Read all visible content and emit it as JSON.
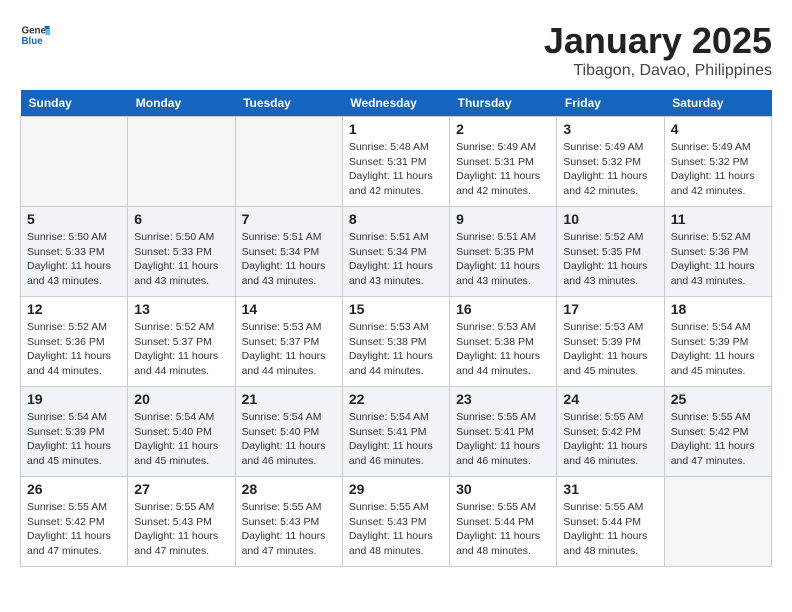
{
  "logo": {
    "text_general": "General",
    "text_blue": "Blue"
  },
  "title": "January 2025",
  "location": "Tibagon, Davao, Philippines",
  "days_of_week": [
    "Sunday",
    "Monday",
    "Tuesday",
    "Wednesday",
    "Thursday",
    "Friday",
    "Saturday"
  ],
  "weeks": [
    [
      {
        "day": "",
        "sunrise": "",
        "sunset": "",
        "daylight": "",
        "empty": true
      },
      {
        "day": "",
        "sunrise": "",
        "sunset": "",
        "daylight": "",
        "empty": true
      },
      {
        "day": "",
        "sunrise": "",
        "sunset": "",
        "daylight": "",
        "empty": true
      },
      {
        "day": "1",
        "sunrise": "Sunrise: 5:48 AM",
        "sunset": "Sunset: 5:31 PM",
        "daylight": "Daylight: 11 hours and 42 minutes.",
        "empty": false
      },
      {
        "day": "2",
        "sunrise": "Sunrise: 5:49 AM",
        "sunset": "Sunset: 5:31 PM",
        "daylight": "Daylight: 11 hours and 42 minutes.",
        "empty": false
      },
      {
        "day": "3",
        "sunrise": "Sunrise: 5:49 AM",
        "sunset": "Sunset: 5:32 PM",
        "daylight": "Daylight: 11 hours and 42 minutes.",
        "empty": false
      },
      {
        "day": "4",
        "sunrise": "Sunrise: 5:49 AM",
        "sunset": "Sunset: 5:32 PM",
        "daylight": "Daylight: 11 hours and 42 minutes.",
        "empty": false
      }
    ],
    [
      {
        "day": "5",
        "sunrise": "Sunrise: 5:50 AM",
        "sunset": "Sunset: 5:33 PM",
        "daylight": "Daylight: 11 hours and 43 minutes.",
        "empty": false
      },
      {
        "day": "6",
        "sunrise": "Sunrise: 5:50 AM",
        "sunset": "Sunset: 5:33 PM",
        "daylight": "Daylight: 11 hours and 43 minutes.",
        "empty": false
      },
      {
        "day": "7",
        "sunrise": "Sunrise: 5:51 AM",
        "sunset": "Sunset: 5:34 PM",
        "daylight": "Daylight: 11 hours and 43 minutes.",
        "empty": false
      },
      {
        "day": "8",
        "sunrise": "Sunrise: 5:51 AM",
        "sunset": "Sunset: 5:34 PM",
        "daylight": "Daylight: 11 hours and 43 minutes.",
        "empty": false
      },
      {
        "day": "9",
        "sunrise": "Sunrise: 5:51 AM",
        "sunset": "Sunset: 5:35 PM",
        "daylight": "Daylight: 11 hours and 43 minutes.",
        "empty": false
      },
      {
        "day": "10",
        "sunrise": "Sunrise: 5:52 AM",
        "sunset": "Sunset: 5:35 PM",
        "daylight": "Daylight: 11 hours and 43 minutes.",
        "empty": false
      },
      {
        "day": "11",
        "sunrise": "Sunrise: 5:52 AM",
        "sunset": "Sunset: 5:36 PM",
        "daylight": "Daylight: 11 hours and 43 minutes.",
        "empty": false
      }
    ],
    [
      {
        "day": "12",
        "sunrise": "Sunrise: 5:52 AM",
        "sunset": "Sunset: 5:36 PM",
        "daylight": "Daylight: 11 hours and 44 minutes.",
        "empty": false
      },
      {
        "day": "13",
        "sunrise": "Sunrise: 5:52 AM",
        "sunset": "Sunset: 5:37 PM",
        "daylight": "Daylight: 11 hours and 44 minutes.",
        "empty": false
      },
      {
        "day": "14",
        "sunrise": "Sunrise: 5:53 AM",
        "sunset": "Sunset: 5:37 PM",
        "daylight": "Daylight: 11 hours and 44 minutes.",
        "empty": false
      },
      {
        "day": "15",
        "sunrise": "Sunrise: 5:53 AM",
        "sunset": "Sunset: 5:38 PM",
        "daylight": "Daylight: 11 hours and 44 minutes.",
        "empty": false
      },
      {
        "day": "16",
        "sunrise": "Sunrise: 5:53 AM",
        "sunset": "Sunset: 5:38 PM",
        "daylight": "Daylight: 11 hours and 44 minutes.",
        "empty": false
      },
      {
        "day": "17",
        "sunrise": "Sunrise: 5:53 AM",
        "sunset": "Sunset: 5:39 PM",
        "daylight": "Daylight: 11 hours and 45 minutes.",
        "empty": false
      },
      {
        "day": "18",
        "sunrise": "Sunrise: 5:54 AM",
        "sunset": "Sunset: 5:39 PM",
        "daylight": "Daylight: 11 hours and 45 minutes.",
        "empty": false
      }
    ],
    [
      {
        "day": "19",
        "sunrise": "Sunrise: 5:54 AM",
        "sunset": "Sunset: 5:39 PM",
        "daylight": "Daylight: 11 hours and 45 minutes.",
        "empty": false
      },
      {
        "day": "20",
        "sunrise": "Sunrise: 5:54 AM",
        "sunset": "Sunset: 5:40 PM",
        "daylight": "Daylight: 11 hours and 45 minutes.",
        "empty": false
      },
      {
        "day": "21",
        "sunrise": "Sunrise: 5:54 AM",
        "sunset": "Sunset: 5:40 PM",
        "daylight": "Daylight: 11 hours and 46 minutes.",
        "empty": false
      },
      {
        "day": "22",
        "sunrise": "Sunrise: 5:54 AM",
        "sunset": "Sunset: 5:41 PM",
        "daylight": "Daylight: 11 hours and 46 minutes.",
        "empty": false
      },
      {
        "day": "23",
        "sunrise": "Sunrise: 5:55 AM",
        "sunset": "Sunset: 5:41 PM",
        "daylight": "Daylight: 11 hours and 46 minutes.",
        "empty": false
      },
      {
        "day": "24",
        "sunrise": "Sunrise: 5:55 AM",
        "sunset": "Sunset: 5:42 PM",
        "daylight": "Daylight: 11 hours and 46 minutes.",
        "empty": false
      },
      {
        "day": "25",
        "sunrise": "Sunrise: 5:55 AM",
        "sunset": "Sunset: 5:42 PM",
        "daylight": "Daylight: 11 hours and 47 minutes.",
        "empty": false
      }
    ],
    [
      {
        "day": "26",
        "sunrise": "Sunrise: 5:55 AM",
        "sunset": "Sunset: 5:42 PM",
        "daylight": "Daylight: 11 hours and 47 minutes.",
        "empty": false
      },
      {
        "day": "27",
        "sunrise": "Sunrise: 5:55 AM",
        "sunset": "Sunset: 5:43 PM",
        "daylight": "Daylight: 11 hours and 47 minutes.",
        "empty": false
      },
      {
        "day": "28",
        "sunrise": "Sunrise: 5:55 AM",
        "sunset": "Sunset: 5:43 PM",
        "daylight": "Daylight: 11 hours and 47 minutes.",
        "empty": false
      },
      {
        "day": "29",
        "sunrise": "Sunrise: 5:55 AM",
        "sunset": "Sunset: 5:43 PM",
        "daylight": "Daylight: 11 hours and 48 minutes.",
        "empty": false
      },
      {
        "day": "30",
        "sunrise": "Sunrise: 5:55 AM",
        "sunset": "Sunset: 5:44 PM",
        "daylight": "Daylight: 11 hours and 48 minutes.",
        "empty": false
      },
      {
        "day": "31",
        "sunrise": "Sunrise: 5:55 AM",
        "sunset": "Sunset: 5:44 PM",
        "daylight": "Daylight: 11 hours and 48 minutes.",
        "empty": false
      },
      {
        "day": "",
        "sunrise": "",
        "sunset": "",
        "daylight": "",
        "empty": true
      }
    ]
  ]
}
